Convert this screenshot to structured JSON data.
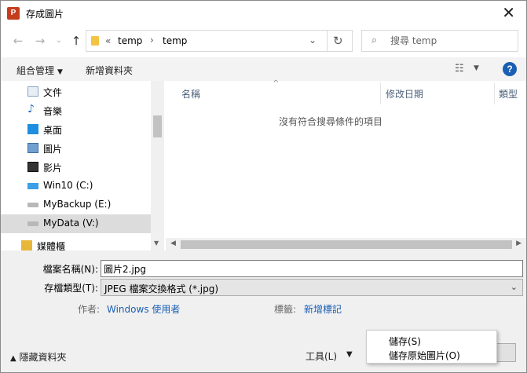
{
  "window": {
    "title": "存成圖片",
    "app_icon": "P"
  },
  "address": {
    "chevron": "«",
    "segments": [
      "temp",
      "temp"
    ]
  },
  "search": {
    "placeholder": "搜尋 temp"
  },
  "command_bar": {
    "organize": "組合管理",
    "new_folder": "新增資料夾"
  },
  "nav_items": [
    {
      "label": "文件",
      "icon": "document-icon"
    },
    {
      "label": "音樂",
      "icon": "music-icon"
    },
    {
      "label": "桌面",
      "icon": "desktop-icon"
    },
    {
      "label": "圖片",
      "icon": "pictures-icon"
    },
    {
      "label": "影片",
      "icon": "videos-icon"
    },
    {
      "label": "Win10 (C:)",
      "icon": "windows-drive-icon"
    },
    {
      "label": "MyBackup (E:)",
      "icon": "drive-icon"
    },
    {
      "label": "MyData (V:)",
      "icon": "drive-icon",
      "selected": true
    },
    {
      "label": "媒體櫃",
      "icon": "library-icon"
    }
  ],
  "file_list": {
    "columns": [
      "名稱",
      "修改日期",
      "類型"
    ],
    "empty_message": "沒有符合搜尋條件的項目"
  },
  "form": {
    "filename_label": "檔案名稱(N):",
    "filename_value": "圖片2.jpg",
    "filetype_label": "存檔類型(T):",
    "filetype_value": "JPEG 檔案交換格式 (*.jpg)",
    "author_label": "作者:",
    "author_value": "Windows 使用者",
    "tags_label": "標籤:",
    "tags_value": "新增標記"
  },
  "footer": {
    "hide_folders": "隱藏資料夾",
    "tools": "工具(L)"
  },
  "menu": {
    "items": [
      "儲存(S)",
      "儲存原始圖片(O)"
    ]
  }
}
